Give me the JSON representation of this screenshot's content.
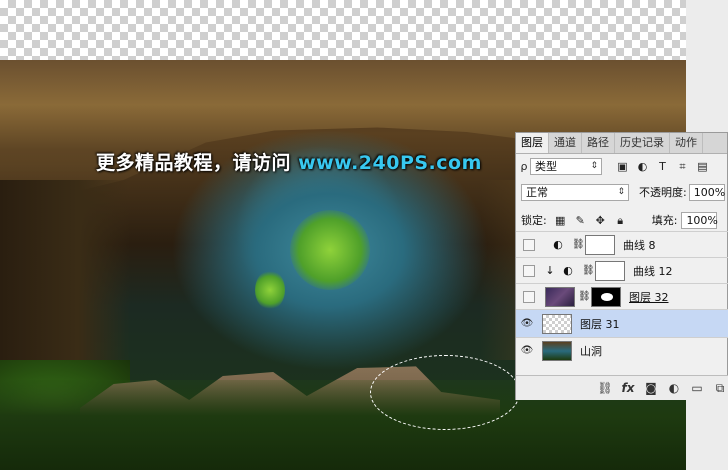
{
  "watermark": {
    "text": "更多精品教程，请访问 ",
    "url": "www.240PS.com"
  },
  "layers_panel": {
    "tabs": [
      "图层",
      "通道",
      "路径",
      "历史记录",
      "动作"
    ],
    "active_tab": "图层",
    "filter": {
      "kind_label": "类型",
      "icons": [
        "image-filter-icon",
        "adjustment-filter-icon",
        "text-filter-icon",
        "shape-filter-icon",
        "smart-object-filter-icon"
      ]
    },
    "blend_mode": "正常",
    "opacity_label": "不透明度:",
    "opacity_value": "100%",
    "lock_label": "锁定:",
    "fill_label": "填充:",
    "fill_value": "100%",
    "layers": [
      {
        "name": "曲线 8",
        "type": "curves",
        "visible": false,
        "selected": false
      },
      {
        "name": "曲线 12",
        "type": "curves",
        "visible": false,
        "selected": false,
        "clipped": true
      },
      {
        "name": "图层 32",
        "type": "image-mask",
        "visible": false,
        "selected": false
      },
      {
        "name": "图层 31",
        "type": "transparent",
        "visible": true,
        "selected": true
      },
      {
        "name": "山洞",
        "type": "photo",
        "visible": true,
        "selected": false
      }
    ],
    "footer_icons": [
      "link-layers-icon",
      "fx-icon",
      "add-mask-icon",
      "adjustment-layer-icon",
      "new-group-icon",
      "new-layer-icon"
    ]
  }
}
